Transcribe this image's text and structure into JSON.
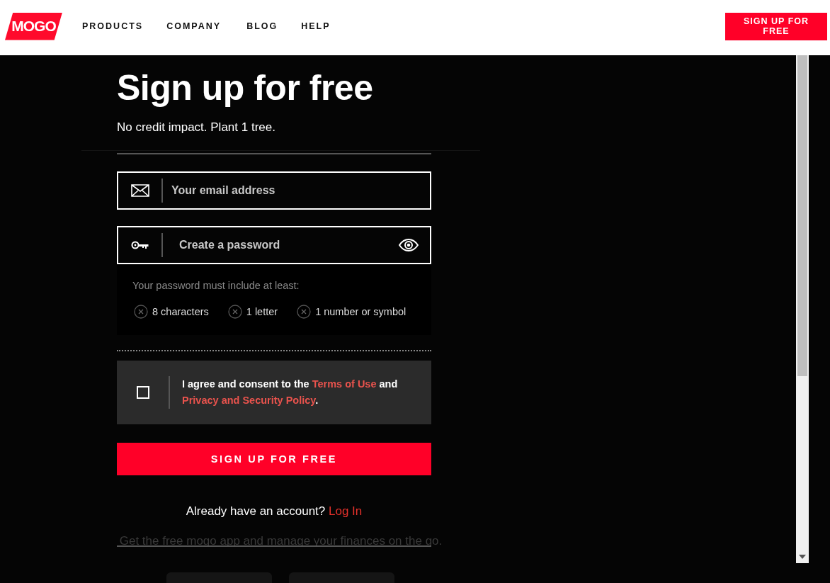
{
  "header": {
    "logo": "MOGO",
    "nav": [
      {
        "label": "PRODUCTS"
      },
      {
        "label": "COMPANY"
      },
      {
        "label": "BLOG"
      },
      {
        "label": "HELP"
      }
    ],
    "cta": "SIGN UP FOR FREE"
  },
  "background_page": {
    "app_note": "Get the free mogo app and manage your finances on the go."
  },
  "signup": {
    "title": "Sign up for free",
    "subtitle": "No credit impact. Plant 1 tree.",
    "email": {
      "placeholder": "Your email address"
    },
    "password": {
      "placeholder": "Create a password"
    },
    "requirements": {
      "intro": "Your password must include at least:",
      "items": [
        {
          "label": "8 characters",
          "met": false
        },
        {
          "label": "1 letter",
          "met": false
        },
        {
          "label": "1 number or symbol",
          "met": false
        }
      ]
    },
    "consent": {
      "checked": false,
      "parts": [
        {
          "text": "I agree and consent to the ",
          "link": false
        },
        {
          "text": "Terms of Use",
          "link": true
        },
        {
          "text": " and ",
          "link": false
        },
        {
          "text": "Privacy and Security Policy",
          "link": true
        },
        {
          "text": ".",
          "link": false
        }
      ]
    },
    "button": "SIGN UP FOR FREE",
    "login_prompt": {
      "text": "Already have an account? ",
      "link": "Log In"
    }
  }
}
